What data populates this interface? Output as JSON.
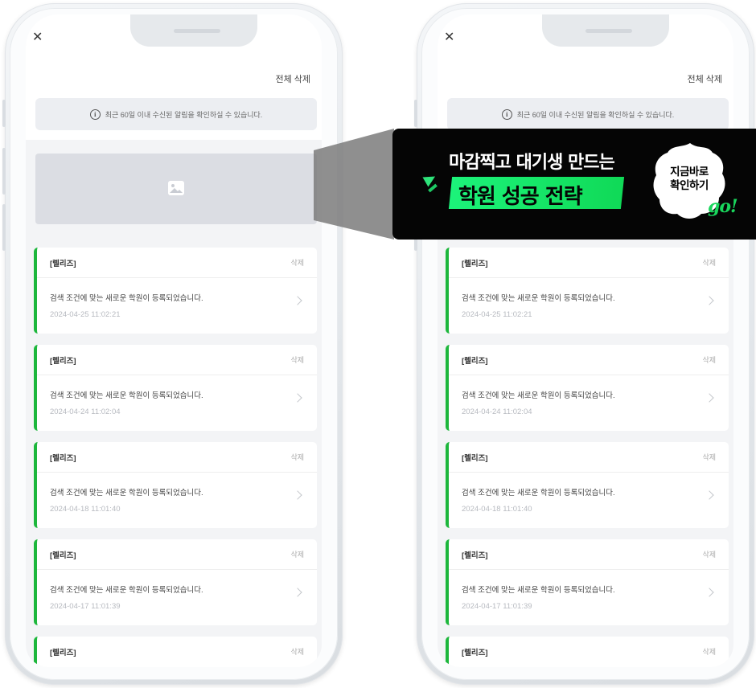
{
  "screens": [
    {
      "close_icon": "✕",
      "header": {
        "delete_all_label": "전체 삭제"
      },
      "notice": {
        "icon": "i",
        "text": "최근 60일 이내 수신된 알림을 확인하실 수 있습니다."
      },
      "banner_placeholder_icon": "image-icon",
      "notifications": [
        {
          "tag": "[렐리즈]",
          "delete_label": "삭제",
          "message": "검색 조건에 맞는 새로운 학원이 등록되었습니다.",
          "date": "2024-04-25 11:02:21"
        },
        {
          "tag": "[렐리즈]",
          "delete_label": "삭제",
          "message": "검색 조건에 맞는 새로운 학원이 등록되었습니다.",
          "date": "2024-04-24 11:02:04"
        },
        {
          "tag": "[렐리즈]",
          "delete_label": "삭제",
          "message": "검색 조건에 맞는 새로운 학원이 등록되었습니다.",
          "date": "2024-04-18 11:01:40"
        },
        {
          "tag": "[렐리즈]",
          "delete_label": "삭제",
          "message": "검색 조건에 맞는 새로운 학원이 등록되었습니다.",
          "date": "2024-04-17 11:01:39"
        },
        {
          "tag": "[렐리즈]",
          "delete_label": "삭제"
        }
      ]
    },
    {
      "close_icon": "✕",
      "header": {
        "delete_all_label": "전체 삭제"
      },
      "notice": {
        "icon": "i",
        "text": "최근 60일 이내 수신된 알림을 확인하실 수 있습니다."
      },
      "notifications": [
        {
          "tag": "[렐리즈]",
          "delete_label": "삭제",
          "message": "검색 조건에 맞는 새로운 학원이 등록되었습니다.",
          "date": "2024-04-25 11:02:21"
        },
        {
          "tag": "[렐리즈]",
          "delete_label": "삭제",
          "message": "검색 조건에 맞는 새로운 학원이 등록되었습니다.",
          "date": "2024-04-24 11:02:04"
        },
        {
          "tag": "[렐리즈]",
          "delete_label": "삭제",
          "message": "검색 조건에 맞는 새로운 학원이 등록되었습니다.",
          "date": "2024-04-18 11:01:40"
        },
        {
          "tag": "[렐리즈]",
          "delete_label": "삭제",
          "message": "검색 조건에 맞는 새로운 학원이 등록되었습니다.",
          "date": "2024-04-17 11:01:39"
        },
        {
          "tag": "[렐리즈]",
          "delete_label": "삭제"
        }
      ]
    }
  ],
  "ad_banner": {
    "line1": "마감찍고 대기생 만드는",
    "line2": "학원 성공 전략",
    "cta": [
      "지금바로",
      "확인하기"
    ],
    "go": "go!",
    "colors": {
      "background": "#050505",
      "highlight": "#1cf37a",
      "accent": "#19d65c"
    }
  },
  "colors": {
    "accent_bar": "#1db73c",
    "notice_bg": "#eceef2",
    "placeholder_bg": "#dbdde3"
  }
}
